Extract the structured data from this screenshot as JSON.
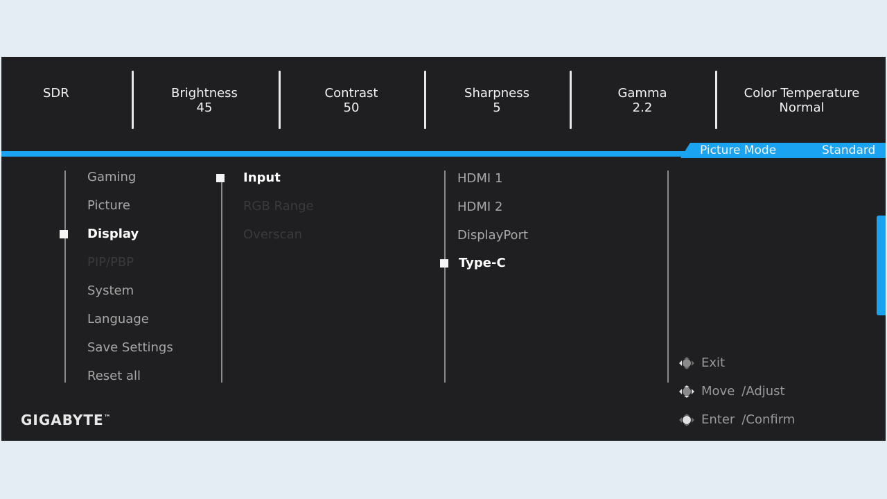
{
  "topbar": {
    "mode": "SDR",
    "stats": [
      {
        "label": "Brightness",
        "value": "45"
      },
      {
        "label": "Contrast",
        "value": "50"
      },
      {
        "label": "Sharpness",
        "value": "5"
      },
      {
        "label": "Gamma",
        "value": "2.2"
      },
      {
        "label": "Color Temperature",
        "value": "Normal"
      }
    ]
  },
  "tab": {
    "label": "Picture Mode",
    "value": "Standard"
  },
  "menu": {
    "main": [
      "Gaming",
      "Picture",
      "Display",
      "PIP/PBP",
      "System",
      "Language",
      "Save Settings",
      "Reset all"
    ],
    "sub": [
      "Input",
      "RGB Range",
      "Overscan"
    ],
    "options": [
      "HDMI 1",
      "HDMI 2",
      "DisplayPort",
      "Type-C"
    ]
  },
  "brand": {
    "name": "GIGABYTE",
    "tm": "™"
  },
  "hints": {
    "exit": "Exit",
    "move": "Move",
    "adjust": "/Adjust",
    "enter": "Enter",
    "confirm": "/Confirm"
  },
  "colors": {
    "accent": "#1aa3f0",
    "background": "#1f1f21"
  }
}
